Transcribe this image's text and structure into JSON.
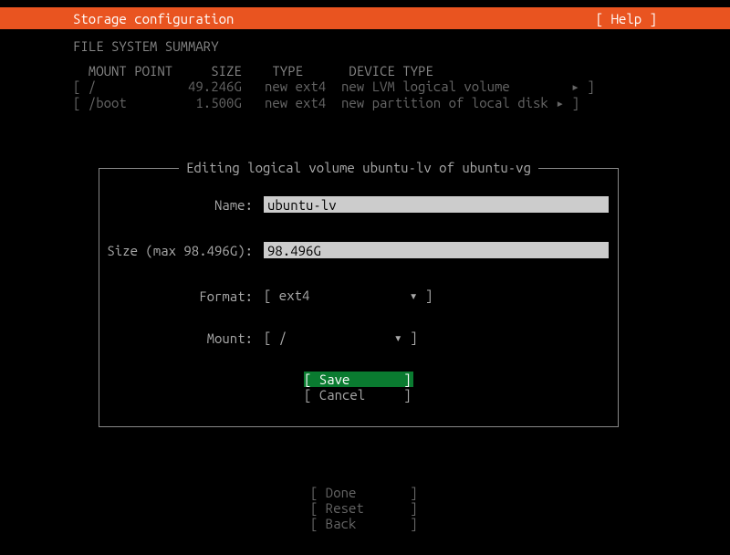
{
  "header": {
    "title": "Storage configuration",
    "help": "[ Help ]"
  },
  "section_title": "FILE SYSTEM SUMMARY",
  "fs": {
    "header": "  MOUNT POINT     SIZE    TYPE      DEVICE TYPE",
    "rows": [
      "[ /            49.246G   new ext4  new LVM logical volume        ▸ ]",
      "[ /boot         1.500G   new ext4  new partition of local disk ▸ ]"
    ]
  },
  "modal": {
    "title": "Editing logical volume ubuntu-lv of ubuntu-vg",
    "name_label": "Name:",
    "name_value": "ubuntu-lv",
    "size_label": "Size (max 98.496G):",
    "size_value": "98.496G",
    "format_label": "Format:",
    "format_select": "[ ext4             ▾ ]",
    "mount_label": "Mount:",
    "mount_select": "[ /              ▾ ]",
    "save": "[ Save       ]",
    "cancel": "[ Cancel     ]"
  },
  "footer": {
    "done": "[ Done       ]",
    "reset": "[ Reset      ]",
    "back": "[ Back       ]"
  }
}
